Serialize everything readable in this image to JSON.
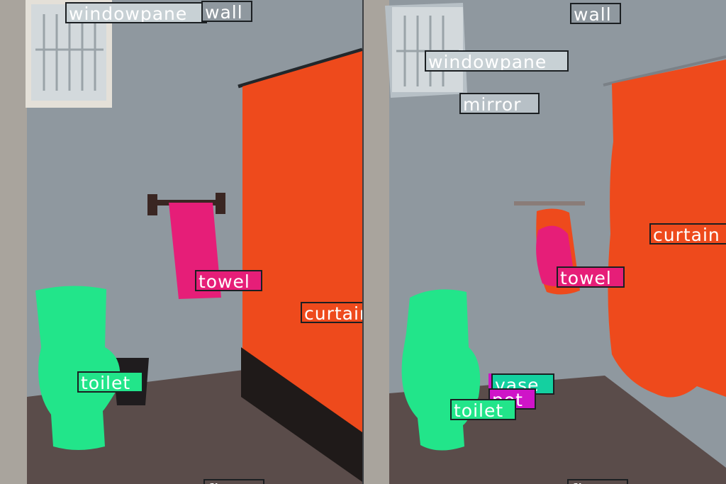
{
  "colors": {
    "wall": "#8f989f",
    "windowpane": "#d3d9dc",
    "mirror": "#b7c0c6",
    "curtain": "#ee4a1c",
    "towel": "#e61e78",
    "toilet": "#22e58a",
    "vase": "#14d0a0",
    "pot": "#cf14c8",
    "floor": "#5a4c4a"
  },
  "panels": {
    "left": {
      "labels": [
        {
          "id": "windowpane",
          "text": "windowpane"
        },
        {
          "id": "wall",
          "text": "wall"
        },
        {
          "id": "towel",
          "text": "towel"
        },
        {
          "id": "curtain",
          "text": "curtain"
        },
        {
          "id": "toilet",
          "text": "toilet"
        },
        {
          "id": "floor",
          "text": "floor"
        }
      ]
    },
    "right": {
      "labels": [
        {
          "id": "wall",
          "text": "wall"
        },
        {
          "id": "windowpane",
          "text": "windowpane"
        },
        {
          "id": "mirror",
          "text": "mirror"
        },
        {
          "id": "curtain",
          "text": "curtain"
        },
        {
          "id": "towel",
          "text": "towel"
        },
        {
          "id": "vase",
          "text": "vase"
        },
        {
          "id": "pot",
          "text": "pot"
        },
        {
          "id": "toilet",
          "text": "toilet"
        },
        {
          "id": "floor",
          "text": "floor"
        }
      ]
    }
  }
}
